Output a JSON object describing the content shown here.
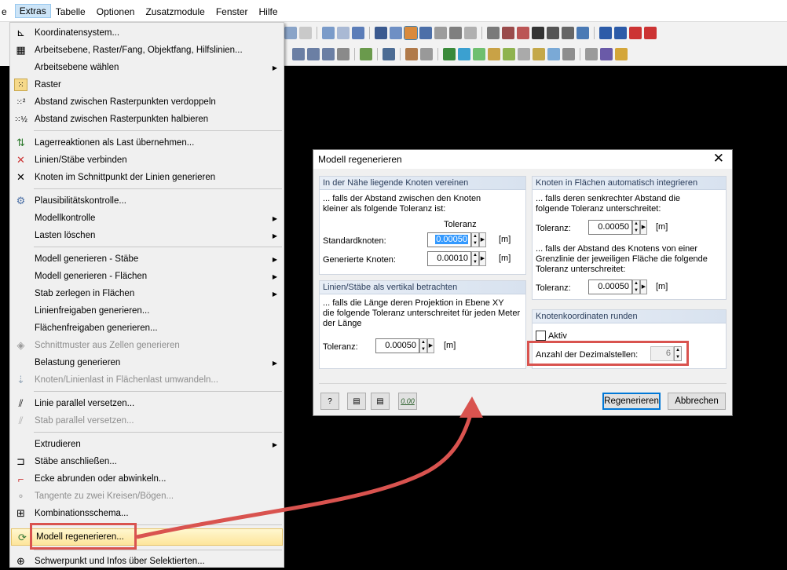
{
  "menubar": {
    "items": [
      "e",
      "Extras",
      "Tabelle",
      "Optionen",
      "Zusatzmodule",
      "Fenster",
      "Hilfe"
    ]
  },
  "menu": {
    "items": [
      {
        "label": "Koordinatensystem...",
        "icon": "coordinate-system-icon"
      },
      {
        "label": "Arbeitsebene, Raster/Fang, Objektfang, Hilfslinien...",
        "icon": "grid-settings-icon"
      },
      {
        "label": "Arbeitsebene wählen",
        "icon": "",
        "submenu": true
      },
      {
        "label": "Raster",
        "icon": "grid-icon"
      },
      {
        "label": "Abstand zwischen Rasterpunkten verdoppeln",
        "icon": "grid-double-icon"
      },
      {
        "label": "Abstand zwischen Rasterpunkten halbieren",
        "icon": "grid-half-icon"
      },
      {
        "label": "Lagerreaktionen als Last übernehmen...",
        "icon": "support-reaction-icon"
      },
      {
        "label": "Linien/Stäbe verbinden",
        "icon": "connect-lines-icon"
      },
      {
        "label": "Knoten im Schnittpunkt der Linien generieren",
        "icon": "intersection-node-icon"
      },
      {
        "label": "Plausibilitätskontrolle...",
        "icon": "plausibility-icon"
      },
      {
        "label": "Modellkontrolle",
        "icon": "",
        "submenu": true
      },
      {
        "label": "Lasten löschen",
        "icon": "",
        "submenu": true
      },
      {
        "label": "Modell generieren - Stäbe",
        "icon": "",
        "submenu": true
      },
      {
        "label": "Modell generieren - Flächen",
        "icon": "",
        "submenu": true
      },
      {
        "label": "Stab zerlegen in Flächen",
        "icon": "",
        "submenu": true
      },
      {
        "label": "Linienfreigaben generieren...",
        "icon": ""
      },
      {
        "label": "Flächenfreigaben generieren...",
        "icon": ""
      },
      {
        "label": "Schnittmuster aus Zellen generieren",
        "icon": "cutting-pattern-icon",
        "disabled": true
      },
      {
        "label": "Belastung generieren",
        "icon": "",
        "submenu": true
      },
      {
        "label": "Knoten/Linienlast in Flächenlast umwandeln...",
        "icon": "load-convert-icon",
        "disabled": true
      },
      {
        "label": "Linie parallel versetzen...",
        "icon": "parallel-line-icon"
      },
      {
        "label": "Stab parallel versetzen...",
        "icon": "parallel-member-icon",
        "disabled": true
      },
      {
        "label": "Extrudieren",
        "icon": "",
        "submenu": true
      },
      {
        "label": "Stäbe anschließen...",
        "icon": "connect-members-icon"
      },
      {
        "label": "Ecke abrunden oder abwinkeln...",
        "icon": "round-corner-icon"
      },
      {
        "label": "Tangente zu zwei Kreisen/Bögen...",
        "icon": "tangent-icon",
        "disabled": true
      },
      {
        "label": "Kombinationsschema...",
        "icon": "combination-scheme-icon"
      },
      {
        "label": "Modell regenerieren...",
        "icon": "regenerate-model-icon",
        "highlighted": true
      },
      {
        "label": "Schwerpunkt und Infos über Selektierten...",
        "icon": "centroid-icon"
      }
    ]
  },
  "dialog": {
    "title": "Modell regenerieren",
    "merge": {
      "header": "In der Nähe liegende Knoten vereinen",
      "desc1": "... falls der Abstand zwischen den Knoten",
      "desc2": "kleiner als folgende Toleranz ist:",
      "tol_header": "Toleranz",
      "standard_label": "Standardknoten:",
      "standard_value": "0.00050",
      "generated_label": "Generierte Knoten:",
      "generated_value": "0.00010",
      "unit": "[m]"
    },
    "vertical": {
      "header": "Linien/Stäbe als vertikal betrachten",
      "desc1": "... falls die Länge deren Projektion in Ebene XY",
      "desc2": "die folgende Toleranz unterschreitet für jeden Meter",
      "desc3": "der Länge",
      "tol_label": "Toleranz:",
      "tol_value": "0.00050",
      "unit": "[m]"
    },
    "surfaces": {
      "header": "Knoten in Flächen automatisch integrieren",
      "desc1": "... falls deren senkrechter Abstand die",
      "desc2": "folgende Toleranz unterschreitet:",
      "tol1_label": "Toleranz:",
      "tol1_value": "0.00050",
      "desc3": "... falls der Abstand des Knotens von einer",
      "desc4": "Grenzlinie der jeweiligen Fläche die folgende",
      "desc5": "Toleranz unterschreitet:",
      "tol2_label": "Toleranz:",
      "tol2_value": "0.00050",
      "unit": "[m]"
    },
    "round": {
      "header": "Knotenkoordinaten runden",
      "active_label": "Aktiv",
      "decimals_label": "Anzahl der Dezimalstellen:",
      "decimals_value": "6"
    },
    "buttons": {
      "regenerate": "Regenerieren",
      "cancel": "Abbrechen",
      "units_icon_text": "0.00"
    }
  },
  "colors": {
    "highlight_box": "#d9534f",
    "arrow": "#d9534f"
  }
}
